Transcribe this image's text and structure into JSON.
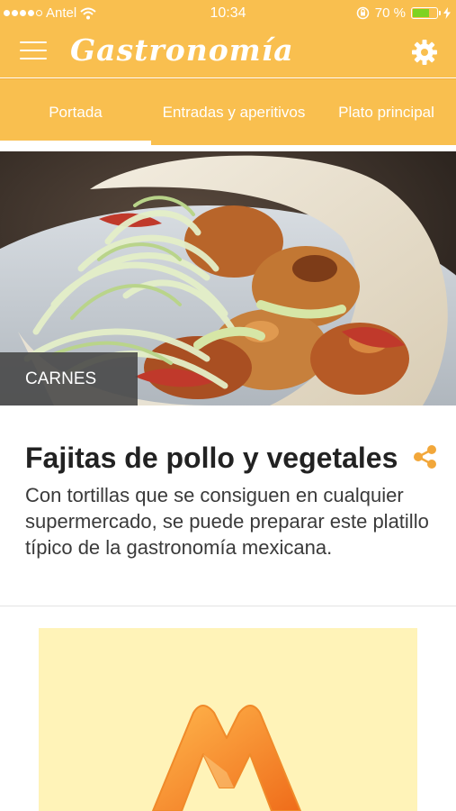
{
  "status_bar": {
    "carrier": "Antel",
    "time": "10:34",
    "battery_percent": "70 %",
    "battery_level": 0.7
  },
  "app_bar": {
    "brand_name": "Gastronomía",
    "menu_icon": "hamburger-menu-icon",
    "settings_icon": "gear-icon"
  },
  "tabs": [
    {
      "label": "Portada",
      "active": true
    },
    {
      "label": "Entradas y aperitivos",
      "active": false
    },
    {
      "label": "Plato principal",
      "active": false
    }
  ],
  "article": {
    "category": "CARNES",
    "title": "Fajitas de pollo y vegetales",
    "description": "Con tortillas que se consiguen en cualquier supermercado, se puede preparar este platillo típico de la gastronomía mexicana.",
    "share_icon": "share-icon"
  },
  "ad": {
    "logo_icon": "m-logo-icon"
  },
  "colors": {
    "primary": "#f9bf4f",
    "accent": "#f2a73a",
    "ad_background": "#fff3b8",
    "text": "#222222"
  }
}
